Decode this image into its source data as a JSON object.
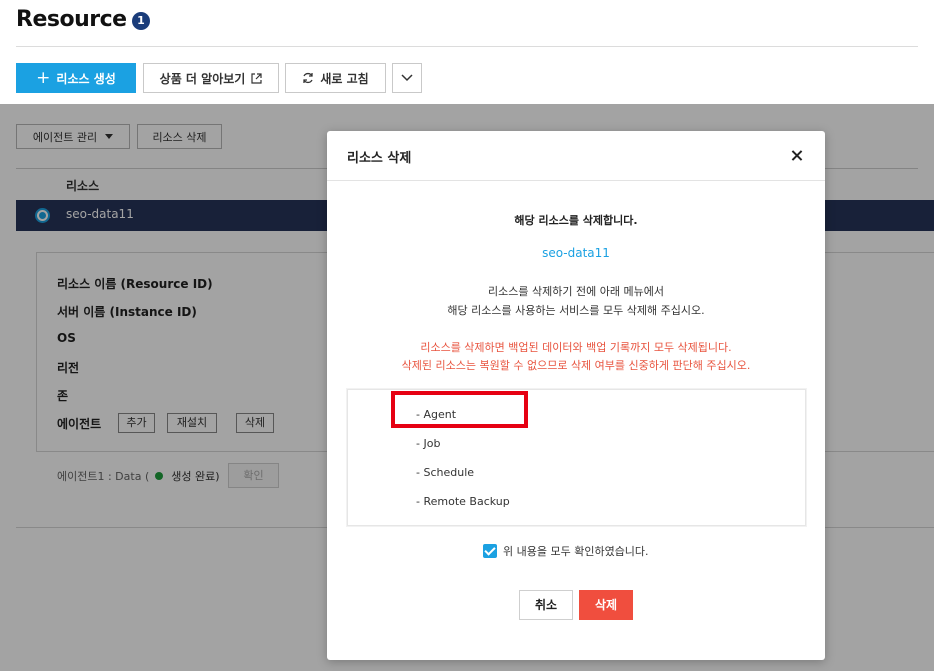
{
  "page": {
    "title": "Resource",
    "badge": "1"
  },
  "toolbar": {
    "create_label": "리소스 생성",
    "learn_label": "상품 더 알아보기",
    "refresh_label": "새로 고침"
  },
  "subtoolbar": {
    "agent_manage": "에이전트 관리",
    "delete_resource": "리소스 삭제"
  },
  "table": {
    "header": "리소스",
    "rows": [
      {
        "name": "seo-data11",
        "selected": true
      }
    ]
  },
  "details": {
    "labels": [
      "리소스 이름 (Resource ID)",
      "서버 이름 (Instance ID)",
      "OS",
      "리전",
      "존",
      "에이전트"
    ],
    "agent_buttons": [
      "추가",
      "재설치",
      "삭제"
    ],
    "agent_status_prefix": "에이전트1 : Data (",
    "agent_status_text": "생성 완료)",
    "confirm_label": "확인"
  },
  "modal": {
    "title": "리소스 삭제",
    "heading": "해당 리소스를 삭제합니다.",
    "resource_name": "seo-data11",
    "info_lines": [
      "리소스를 삭제하기 전에 아래 메뉴에서",
      "해당 리소스를 사용하는 서비스를 모두 삭제해 주십시오."
    ],
    "warning_lines": [
      "리소스를 삭제하면 백업된 데이터와 백업 기록까지 모두 삭제됩니다.",
      "삭제된 리소스는 복원할 수 없으므로 삭제 여부를 신중하게 판단해 주십시오."
    ],
    "services": [
      "- Agent",
      "- Job",
      "- Schedule",
      "- Remote Backup"
    ],
    "acknowledge_label": "위 내용을 모두 확인하였습니다.",
    "acknowledge_checked": true,
    "cancel_label": "취소",
    "delete_label": "삭제"
  },
  "colors": {
    "accent": "#1ba1e2",
    "danger": "#f04e3e",
    "warning_text": "#e8543f",
    "selected_row": "#27345a",
    "highlight": "#e60012"
  }
}
